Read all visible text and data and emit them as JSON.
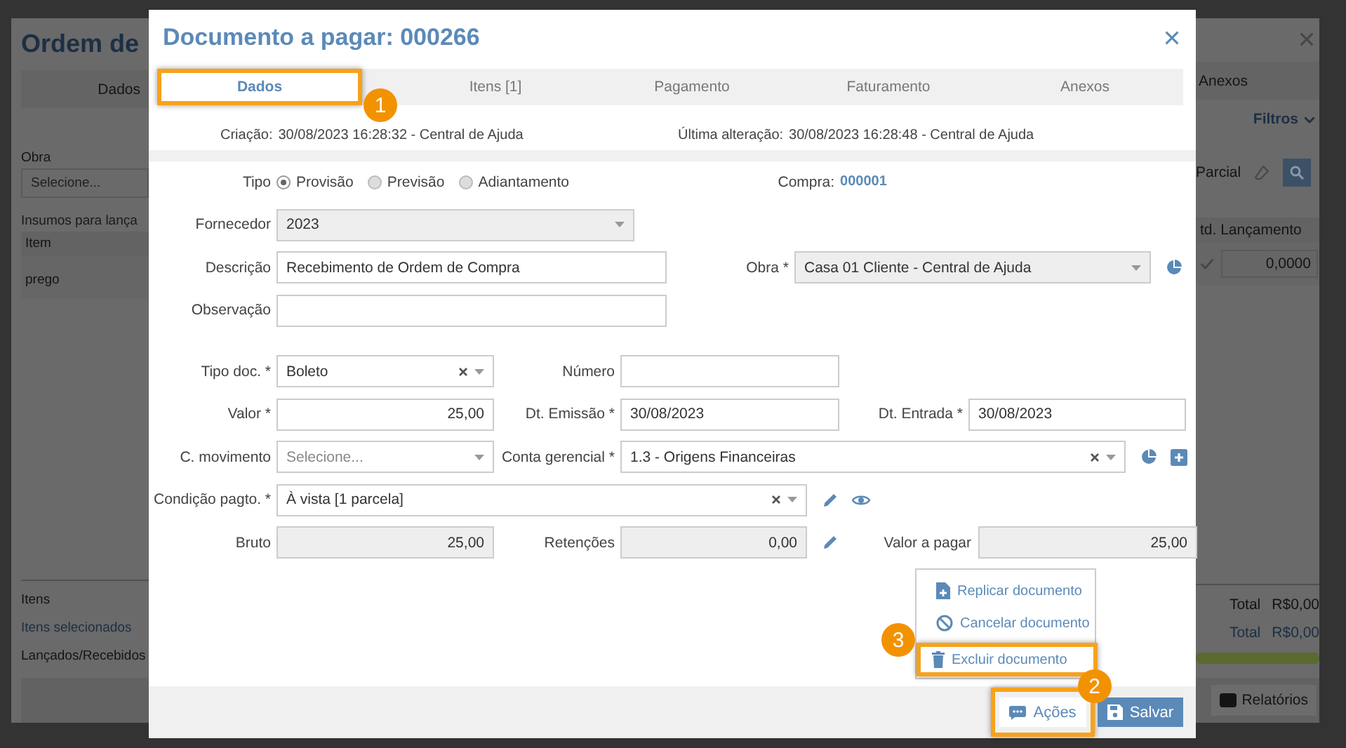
{
  "background": {
    "title": "Ordem de",
    "tabs": [
      {
        "label": "Dados"
      },
      {
        "label": "Anexos"
      }
    ],
    "filters": "Filtros",
    "obra_label": "Obra",
    "obra_placeholder": "Selecione...",
    "section_label": "Insumos para lança",
    "parcial": "Parcial",
    "table": {
      "columns": [
        "Item",
        "td. Lançamento"
      ],
      "rows": [
        {
          "item": "prego",
          "qty": "0,0000"
        }
      ]
    },
    "summary": [
      {
        "label": "Itens",
        "total_label": "Total",
        "total": "R$0,00"
      },
      {
        "label": "Itens selecionados",
        "total_label": "Total",
        "total": "R$0,00"
      },
      {
        "label": "Lançados/Recebidos"
      }
    ],
    "progress": {
      "level": 1
    },
    "reports_button": "Relatórios"
  },
  "dialog": {
    "title": "Documento a pagar: 000266",
    "tabs": [
      {
        "label": "Dados",
        "selected": true,
        "callout": "1"
      },
      {
        "label": "Itens [1]",
        "selected": false
      },
      {
        "label": "Pagamento",
        "selected": false
      },
      {
        "label": "Faturamento",
        "selected": false
      },
      {
        "label": "Anexos",
        "selected": false
      }
    ],
    "created": {
      "label": "Criação:",
      "value": "30/08/2023 16:28:32 - Central de Ajuda"
    },
    "modified": {
      "label": "Última alteração:",
      "value": "30/08/2023 16:28:48 - Central de Ajuda"
    },
    "form": {
      "tipo": {
        "label": "Tipo",
        "options": [
          {
            "label": "Provisão",
            "selected": true
          },
          {
            "label": "Previsão",
            "selected": false
          },
          {
            "label": "Adiantamento",
            "selected": false
          }
        ]
      },
      "compra": {
        "label": "Compra:",
        "value": "000001"
      },
      "fornecedor": {
        "label": "Fornecedor",
        "kind": "select",
        "value": "2023"
      },
      "descricao": {
        "label": "Descrição",
        "kind": "text",
        "value": "Recebimento de Ordem de Compra"
      },
      "obra": {
        "label": "Obra *",
        "kind": "select",
        "value": "Casa 01 Cliente - Central de Ajuda"
      },
      "observacao": {
        "label": "Observação",
        "kind": "text"
      },
      "tipo_doc": {
        "label": "Tipo doc. *",
        "kind": "combo",
        "value": "Boleto"
      },
      "numero": {
        "label": "Número",
        "kind": "text"
      },
      "valor": {
        "label": "Valor *",
        "kind": "text",
        "value": "25,00"
      },
      "dt_emissao": {
        "label": "Dt. Emissão *",
        "kind": "text",
        "value": "30/08/2023"
      },
      "dt_entrada": {
        "label": "Dt. Entrada *",
        "kind": "text",
        "value": "30/08/2023"
      },
      "c_movimento": {
        "label": "C. movimento",
        "kind": "combo",
        "placeholder": "Selecione..."
      },
      "conta_gerencial": {
        "label": "Conta gerencial *",
        "kind": "combo",
        "value": "1.3 - Origens Financeiras"
      },
      "condicao": {
        "label": "Condição pagto. *",
        "kind": "combo",
        "value": "À vista [1 parcela]"
      },
      "bruto": {
        "label": "Bruto",
        "kind": "text",
        "value": "25,00",
        "readonly": true
      },
      "retencoes": {
        "label": "Retenções",
        "kind": "text",
        "value": "0,00",
        "readonly": true
      },
      "valor_a_pagar": {
        "label": "Valor a pagar",
        "kind": "text",
        "value": "25,00",
        "readonly": true
      }
    },
    "actions_menu": {
      "items": [
        {
          "label": "Replicar documento",
          "kind": "replicate"
        },
        {
          "label": "Cancelar documento",
          "kind": "cancel"
        },
        {
          "label": "Excluir documento",
          "kind": "delete",
          "callout": "3"
        }
      ]
    },
    "buttons": [
      {
        "label": "Ações",
        "kind": "actions",
        "callout": "2"
      },
      {
        "label": "Salvar",
        "kind": "save"
      }
    ]
  }
}
